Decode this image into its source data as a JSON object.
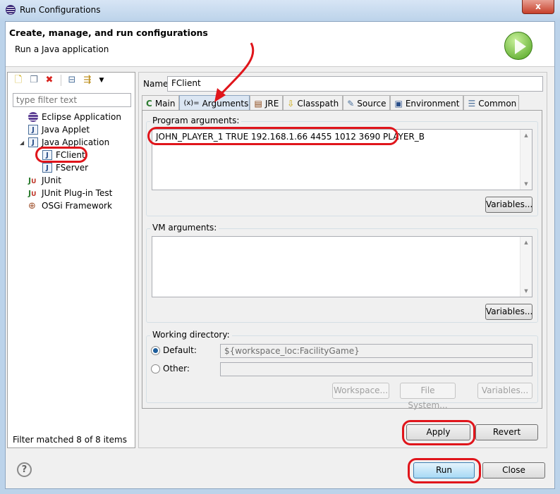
{
  "window": {
    "title": "Run Configurations",
    "close_label": "x"
  },
  "header": {
    "title": "Create, manage, and run configurations",
    "subtitle": "Run a Java application"
  },
  "left": {
    "toolbar": [
      "new-configuration-icon",
      "duplicate-icon",
      "delete-icon",
      "collapse-all-icon",
      "filter-icon",
      "dropdown-icon"
    ],
    "filter_placeholder": "type filter text",
    "tree": [
      {
        "label": "Eclipse Application",
        "icon": "eclipse-icon",
        "level": 0
      },
      {
        "label": "Java Applet",
        "icon": "applet-icon",
        "level": 0
      },
      {
        "label": "Java Application",
        "icon": "java-app-icon",
        "level": 0,
        "expanded": true
      },
      {
        "label": "FClient",
        "icon": "java-app-icon",
        "level": 1,
        "selected": true
      },
      {
        "label": "FServer",
        "icon": "java-app-icon",
        "level": 1
      },
      {
        "label": "JUnit",
        "icon": "junit-icon",
        "level": 0
      },
      {
        "label": "JUnit Plug-in Test",
        "icon": "junit-plugin-icon",
        "level": 0
      },
      {
        "label": "OSGi Framework",
        "icon": "osgi-icon",
        "level": 0
      }
    ],
    "status": "Filter matched 8 of 8 items"
  },
  "main": {
    "name_label": "Name:",
    "name_value": "FClient",
    "tabs": [
      {
        "label": "Main",
        "icon": "C"
      },
      {
        "label": "Arguments",
        "icon": "(x)=",
        "active": true
      },
      {
        "label": "JRE",
        "icon": "▤"
      },
      {
        "label": "Classpath",
        "icon": "⇩"
      },
      {
        "label": "Source",
        "icon": "✎"
      },
      {
        "label": "Environment",
        "icon": "▣"
      },
      {
        "label": "Common",
        "icon": "☰"
      }
    ],
    "program_args": {
      "label": "Program arguments:",
      "value": "JOHN_PLAYER_1 TRUE 192.168.1.66 4455 1012 3690 PLAYER_B",
      "variables": "Variables..."
    },
    "vm_args": {
      "label": "VM arguments:",
      "value": "",
      "variables": "Variables..."
    },
    "working_dir": {
      "label": "Working directory:",
      "default_label": "Default:",
      "default_value": "${workspace_loc:FacilityGame}",
      "default_selected": true,
      "other_label": "Other:",
      "other_value": "",
      "buttons": [
        "Workspace...",
        "File System...",
        "Variables..."
      ]
    },
    "apply": "Apply",
    "revert": "Revert"
  },
  "footer": {
    "run": "Run",
    "close": "Close",
    "help": "?"
  },
  "colors": {
    "annotation": "#e0151b",
    "accent": "#3c7fb1"
  }
}
